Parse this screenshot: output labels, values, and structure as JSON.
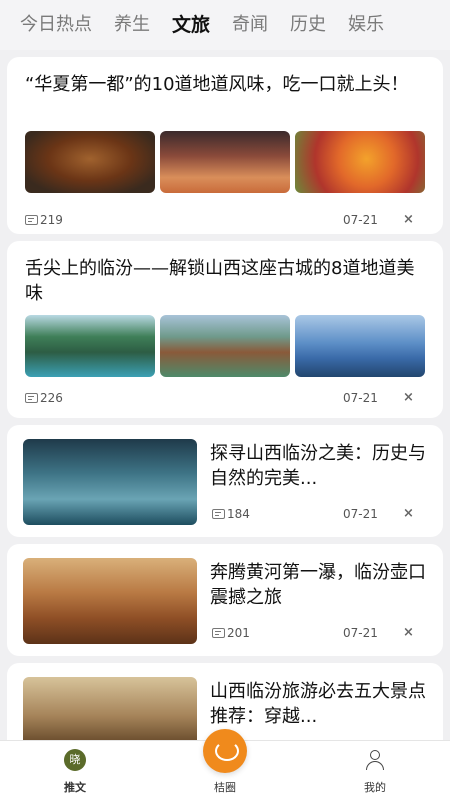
{
  "tabs": [
    "今日热点",
    "养生",
    "文旅",
    "奇闻",
    "历史",
    "娱乐"
  ],
  "active_tab": "文旅",
  "articles": [
    {
      "title": "“华夏第一都”的10道地道风味，吃一口就上头！",
      "images": [
        "burger-icon",
        "food-vendor-icon",
        "fruit-basket-icon"
      ],
      "comments": "219",
      "date": "07-21",
      "close": "×"
    },
    {
      "title": "舌尖上的临汾——解锁山西这座古城的8道地道美味",
      "images": [
        "canyon-icon",
        "village-icon",
        "ship-icon"
      ],
      "comments": "226",
      "date": "07-21",
      "close": "×"
    },
    {
      "title": "探寻山西临汾之美：历史与自然的完美...",
      "images": [
        "boat-icon"
      ],
      "comments": "184",
      "date": "07-21",
      "close": "×"
    },
    {
      "title": "奔腾黄河第一瀑，临汾壶口震撼之旅",
      "images": [
        "desert-car-icon"
      ],
      "comments": "201",
      "date": "07-21",
      "close": "×"
    },
    {
      "title": "山西临汾旅游必去五大景点推荐：穿越...",
      "images": [
        "temple-icon"
      ]
    }
  ],
  "bottom_nav": {
    "home_label": "推文",
    "home_icon_text": "晓",
    "center_label": "桔圈",
    "me_label": "我的"
  },
  "colors": {
    "accent": "#f08a1c",
    "home_icon": "#5b6b2a"
  }
}
